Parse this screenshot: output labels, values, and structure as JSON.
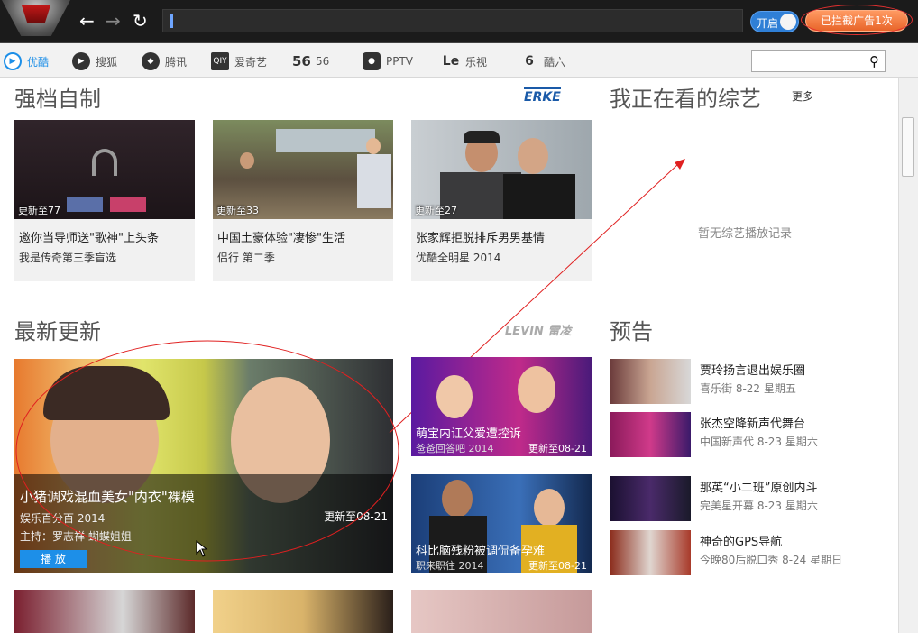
{
  "browser": {
    "back_icon": "←",
    "forward_icon": "→",
    "refresh_icon": "↻",
    "url": "",
    "toggle_label": "开启",
    "adblock_label": "已拦截广告1次"
  },
  "tabs": [
    {
      "label": "优酷",
      "icon": "youku-icon",
      "glyph": "▶",
      "active": true
    },
    {
      "label": "搜狐",
      "icon": "sohu-icon",
      "glyph": "▶",
      "active": false
    },
    {
      "label": "腾讯",
      "icon": "tencent-icon",
      "glyph": "◆",
      "active": false
    },
    {
      "label": "爱奇艺",
      "icon": "iqiyi-icon",
      "glyph": "QIY",
      "active": false
    },
    {
      "label": "56",
      "icon": "56-icon",
      "glyph": "56",
      "active": false
    },
    {
      "label": "PPTV",
      "icon": "pptv-icon",
      "glyph": "●",
      "active": false
    },
    {
      "label": "乐视",
      "icon": "letv-icon",
      "glyph": "Le",
      "active": false
    },
    {
      "label": "酷六",
      "icon": "ku6-icon",
      "glyph": "6",
      "active": false
    }
  ],
  "search": {
    "placeholder": "",
    "icon": "search-icon"
  },
  "sections": {
    "originals_title": "强档自制",
    "originals_sponsor": "ERKE",
    "latest_title": "最新更新",
    "latest_sponsor": "LEVIN 雷凌",
    "watching_title": "我正在看的综艺",
    "watching_more": "更多",
    "watching_empty": "暂无综艺播放记录",
    "preview_title": "预告"
  },
  "originals": [
    {
      "update": "更新至77",
      "title": "邀你当导师送\"歌神\"上头条",
      "subtitle": "我是传奇第三季盲选"
    },
    {
      "update": "更新至33",
      "title": "中国土豪体验\"凄惨\"生活",
      "subtitle": "侣行 第二季"
    },
    {
      "update": "更新至27",
      "title": "张家辉拒脱排斥男男基情",
      "subtitle": "优酷全明星 2014"
    }
  ],
  "featured": {
    "title": "小猪调戏混血美女\"内衣\"裸模",
    "show": "娱乐百分百 2014",
    "update": "更新至08-21",
    "host": "主持：罗志祥 蝴蝶姐姐",
    "play": "播 放"
  },
  "latest_side": [
    {
      "title": "萌宝内讧父爱遭控诉",
      "show": "爸爸回答吧 2014",
      "update": "更新至08-21"
    },
    {
      "title": "科比脑残粉被调侃备孕难",
      "show": "职来职往 2014",
      "update": "更新至08-21"
    }
  ],
  "previews": [
    {
      "title": "贾玲扬言退出娱乐圈",
      "meta": "喜乐街 8-22 星期五"
    },
    {
      "title": "张杰空降新声代舞台",
      "meta": "中国新声代 8-23 星期六"
    },
    {
      "title": "那英“小二班”原创内斗",
      "meta": "完美星开幕 8-23 星期六"
    },
    {
      "title": "神奇的GPS导航",
      "meta": "今晚80后脱口秀 8-24 星期日"
    }
  ]
}
